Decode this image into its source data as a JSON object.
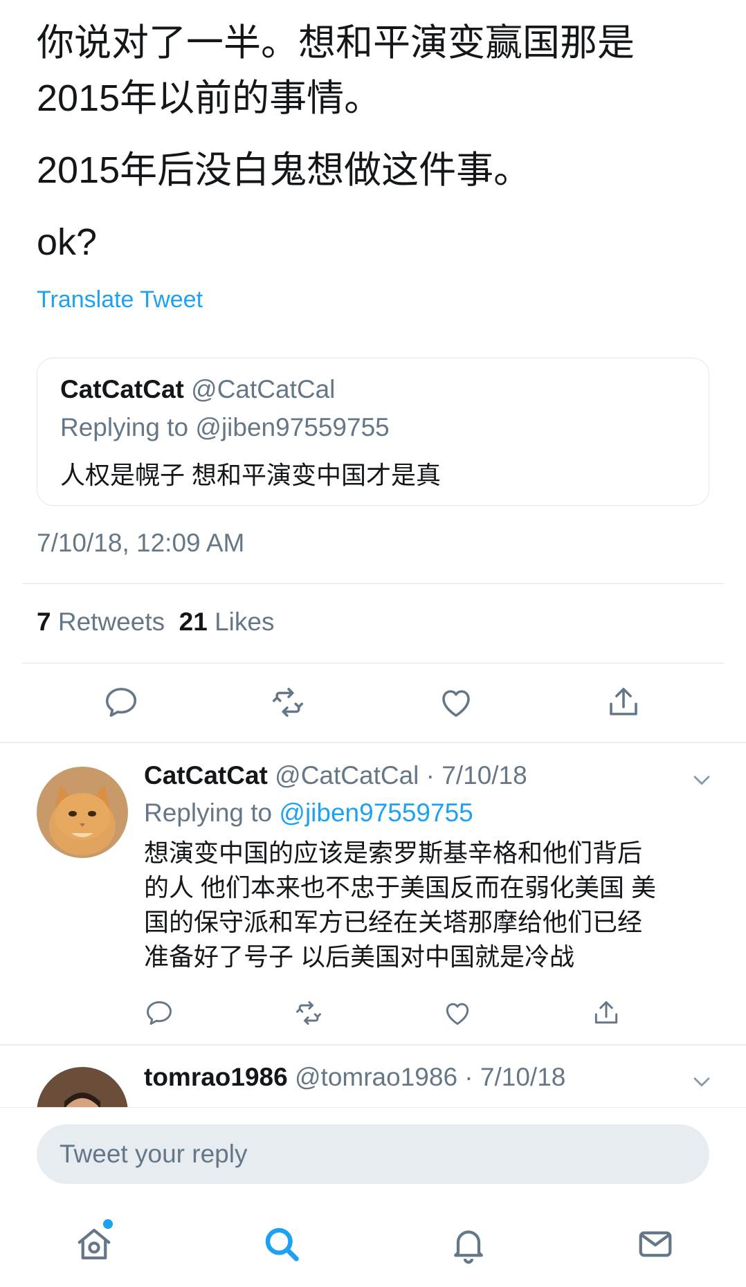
{
  "tweet": {
    "lines": [
      "你说对了一半。想和平演变赢国那是",
      "2015年以前的事情。",
      "2015年后没白鬼想做这件事。",
      "ok?"
    ],
    "translate_label": "Translate Tweet",
    "quoted": {
      "name": "CatCatCat",
      "handle": "@CatCatCal",
      "replying_to": "Replying to @jiben97559755",
      "text": "人权是幌子 想和平演变中国才是真"
    },
    "timestamp": "7/10/18, 12:09 AM",
    "retweets_count": "7",
    "retweets_label": "Retweets",
    "likes_count": "21",
    "likes_label": "Likes"
  },
  "replies": [
    {
      "name": "CatCatCat",
      "meta": "@CatCatCal · 7/10/18",
      "replying_prefix": "Replying to",
      "replying_handle": "@jiben97559755",
      "lines": [
        "想演变中国的应该是索罗斯基辛格和他们背后",
        "的人 他们本来也不忠于美国反而在弱化美国 美",
        "国的保守派和军方已经在关塔那摩给他们已经",
        "准备好了号子 以后美国对中国就是冷战"
      ]
    },
    {
      "name": "tomrao1986",
      "meta": "@tomrao1986 · 7/10/18"
    }
  ],
  "reply_box": {
    "placeholder": "Tweet your reply"
  },
  "colors": {
    "accent": "#1da1f2",
    "secondary_text": "#657786",
    "divider": "#e1e8ed"
  },
  "icons": {
    "actions": [
      "reply-icon",
      "retweet-icon",
      "like-icon",
      "share-icon"
    ],
    "tabs": [
      "home-icon",
      "search-icon",
      "notifications-icon",
      "messages-icon"
    ]
  }
}
